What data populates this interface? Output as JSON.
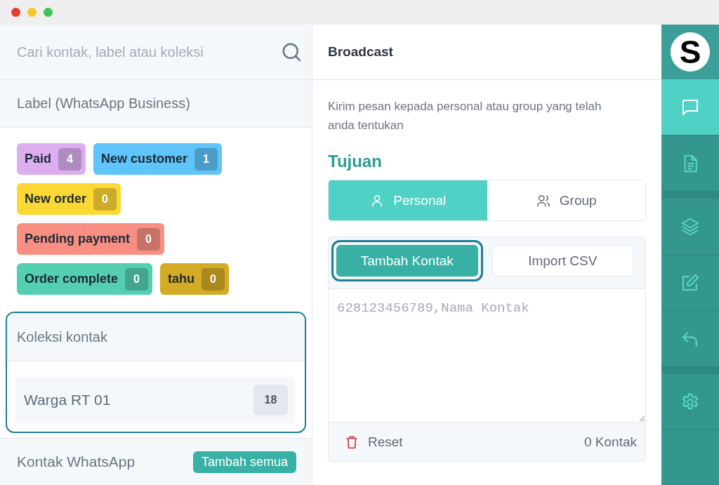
{
  "search": {
    "placeholder": "Cari kontak, label atau koleksi"
  },
  "labels_section": {
    "title": "Label (WhatsApp Business)",
    "labels": [
      {
        "name": "Paid",
        "count": "4",
        "color": "#dcaef0"
      },
      {
        "name": "New customer",
        "count": "1",
        "color": "#5ec4f9"
      },
      {
        "name": "New order",
        "count": "0",
        "color": "#fdd835"
      },
      {
        "name": "Pending payment",
        "count": "0",
        "color": "#f98f82"
      },
      {
        "name": "Order complete",
        "count": "0",
        "color": "#55cfb2"
      },
      {
        "name": "tahu",
        "count": "0",
        "color": "#d4ab24"
      }
    ]
  },
  "collections": {
    "title": "Koleksi kontak",
    "highlighted": true,
    "items": [
      {
        "name": "Warga RT 01",
        "count": "18"
      }
    ]
  },
  "whatsapp_contacts": {
    "title": "Kontak WhatsApp",
    "button": "Tambah semua"
  },
  "broadcast": {
    "title": "Broadcast",
    "description": "Kirim pesan kepada personal atau group yang telah anda tentukan",
    "section_title": "Tujuan",
    "tabs": [
      {
        "label": "Personal",
        "selected": true
      },
      {
        "label": "Group",
        "selected": false
      }
    ],
    "subtabs": [
      {
        "label": "Tambah Kontak",
        "selected": true,
        "highlighted": true
      },
      {
        "label": "Import CSV",
        "selected": false,
        "highlighted": false
      }
    ],
    "textarea": {
      "placeholder": "628123456789,Nama Kontak"
    },
    "reset": "Reset",
    "contact_count": "0 Kontak"
  },
  "rail": {
    "logo": "S",
    "items": [
      {
        "selected": true
      },
      {
        "selected": false
      },
      {
        "selected": false
      },
      {
        "selected": false
      },
      {
        "selected": false
      },
      {
        "selected": false
      }
    ]
  }
}
